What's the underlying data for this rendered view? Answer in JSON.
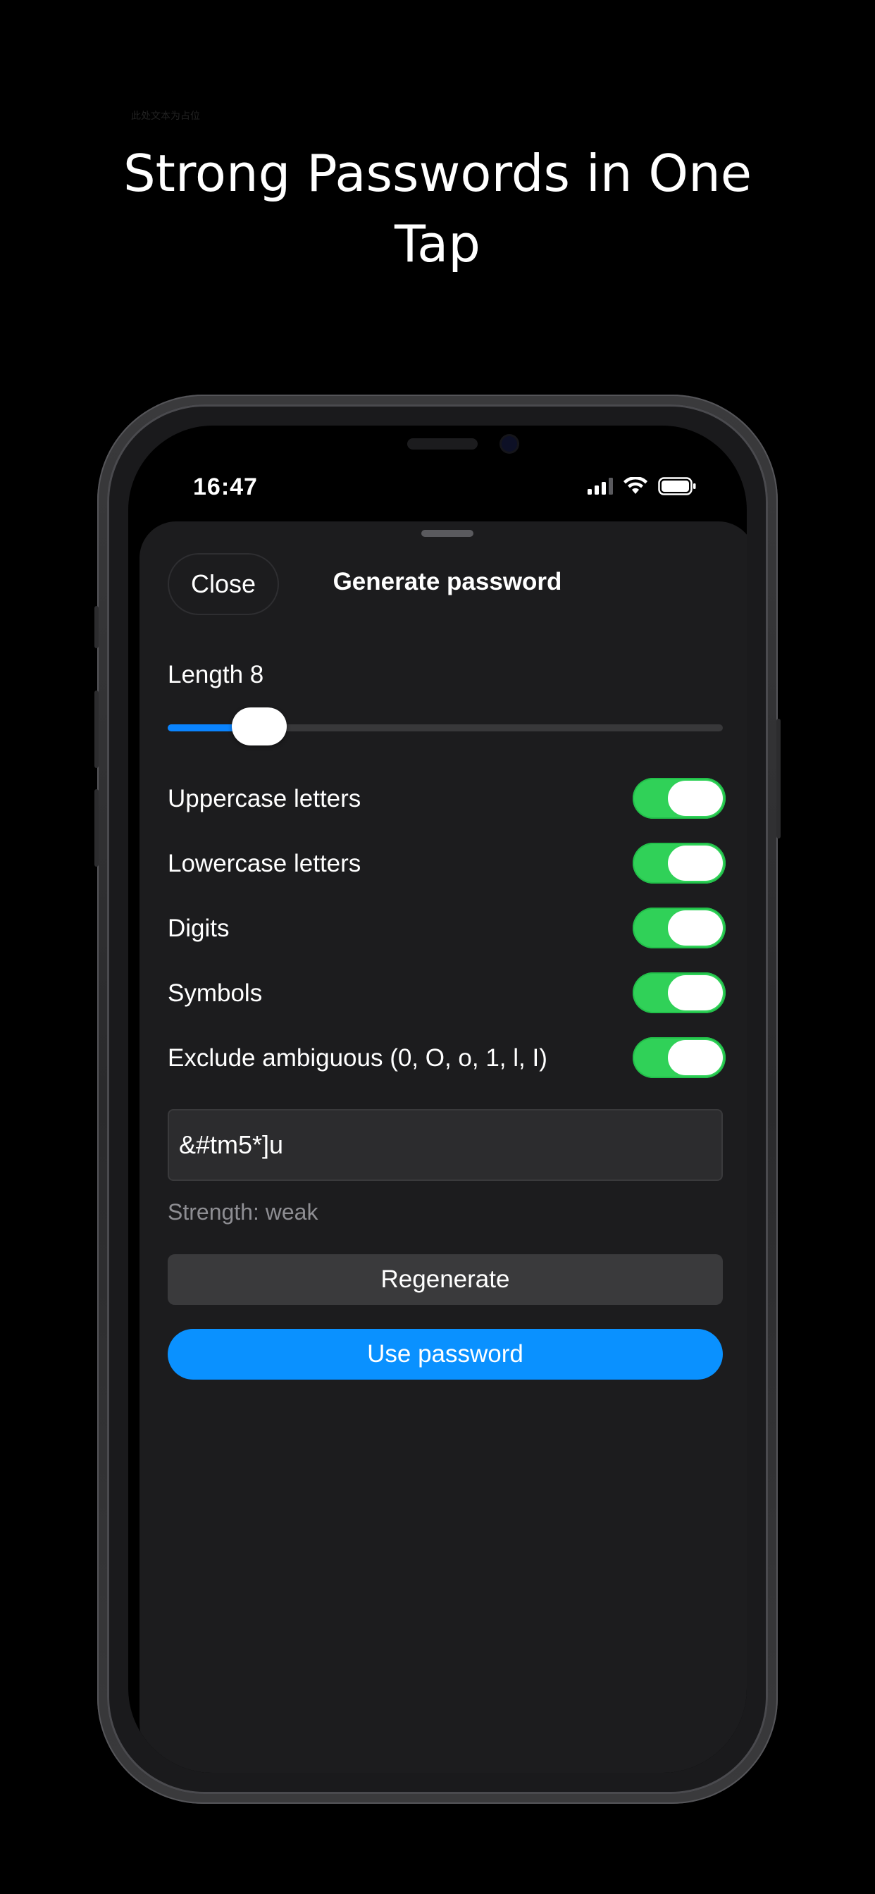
{
  "caption": "此处文本为占位",
  "headline": {
    "line1": "Strong Passwords in One",
    "line2": "Tap"
  },
  "status_bar": {
    "time": "16:47",
    "icons": [
      "cellular-signal-icon",
      "wifi-icon",
      "battery-icon"
    ]
  },
  "sheet": {
    "close_label": "Close",
    "title": "Generate password",
    "length_label": "Length 8",
    "length_value": 8,
    "length_slider_fraction": 0.12,
    "options": [
      {
        "label": "Uppercase letters",
        "enabled": true
      },
      {
        "label": "Lowercase letters",
        "enabled": true
      },
      {
        "label": "Digits",
        "enabled": true
      },
      {
        "label": "Symbols",
        "enabled": true
      },
      {
        "label": "Exclude ambiguous (0, O, o, 1, l, I)",
        "enabled": true
      }
    ],
    "password_value": "&#tm5*]u",
    "strength_text": "Strength: weak",
    "regenerate_label": "Regenerate",
    "use_label": "Use password"
  },
  "colors": {
    "accent_blue": "#0a84ff",
    "use_button_blue": "#0a91ff",
    "toggle_green": "#30d158",
    "sheet_background": "#1c1c1e"
  }
}
